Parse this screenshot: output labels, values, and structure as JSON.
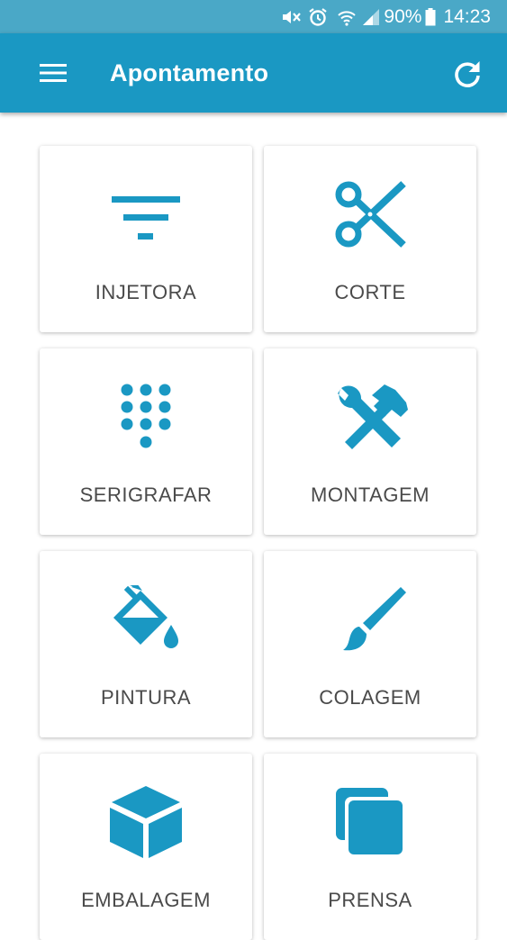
{
  "status_bar": {
    "battery": "90%",
    "time": "14:23"
  },
  "app_bar": {
    "title": "Apontamento"
  },
  "colors": {
    "status_bar": "#4aa8c7",
    "app_bar": "#1a98c3",
    "accent_icon": "#1a98c3",
    "label_text": "#4a4a4a"
  },
  "tiles": [
    {
      "label": "INJETORA",
      "icon": "filter-icon"
    },
    {
      "label": "CORTE",
      "icon": "scissors-icon"
    },
    {
      "label": "SERIGRAFAR",
      "icon": "dialpad-icon"
    },
    {
      "label": "MONTAGEM",
      "icon": "tools-icon"
    },
    {
      "label": "PINTURA",
      "icon": "paint-bucket-icon"
    },
    {
      "label": "COLAGEM",
      "icon": "brush-icon"
    },
    {
      "label": "EMBALAGEM",
      "icon": "box-icon"
    },
    {
      "label": "PRENSA",
      "icon": "layers-icon"
    }
  ]
}
